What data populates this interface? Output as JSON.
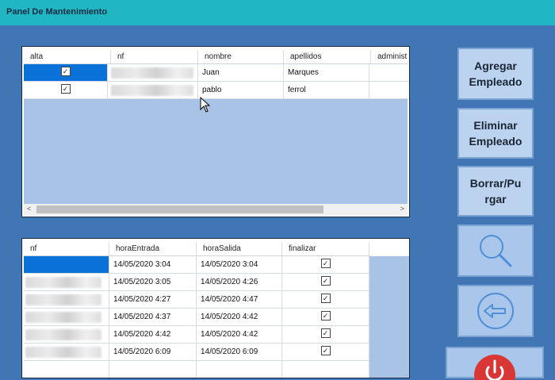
{
  "window": {
    "title": "Panel De Mantenimiento"
  },
  "empleados_grid": {
    "columns": [
      "alta",
      "nf",
      "nombre",
      "apellidos",
      "administ"
    ],
    "rows": [
      {
        "alta": true,
        "nf": "",
        "nombre": "Juan",
        "apellidos": "Marques"
      },
      {
        "alta": true,
        "nf": "",
        "nombre": "pablo",
        "apellidos": "ferrol"
      }
    ]
  },
  "fichajes_grid": {
    "columns": [
      "nf",
      "horaEntrada",
      "horaSalida",
      "finalizar"
    ],
    "rows": [
      {
        "nf": "",
        "horaEntrada": "14/05/2020 3:04",
        "horaSalida": "14/05/2020 3:04",
        "finalizar": true
      },
      {
        "nf": "",
        "horaEntrada": "14/05/2020 3:05",
        "horaSalida": "14/05/2020 4:26",
        "finalizar": true
      },
      {
        "nf": "",
        "horaEntrada": "14/05/2020 4:27",
        "horaSalida": "14/05/2020 4:47",
        "finalizar": true
      },
      {
        "nf": "",
        "horaEntrada": "14/05/2020 4:37",
        "horaSalida": "14/05/2020 4:42",
        "finalizar": true
      },
      {
        "nf": "",
        "horaEntrada": "14/05/2020 4:42",
        "horaSalida": "14/05/2020 4:42",
        "finalizar": true
      },
      {
        "nf": "",
        "horaEntrada": "14/05/2020 6:09",
        "horaSalida": "14/05/2020 6:09",
        "finalizar": true
      }
    ]
  },
  "buttons": {
    "agregar_line1": "Agregar",
    "agregar_line2": "Empleado",
    "eliminar_line1": "Eliminar",
    "eliminar_line2": "Empleado",
    "borrar_line1": "Borrar/Pu",
    "borrar_line2": "rgar",
    "search_icon": "magnifier-icon",
    "back_icon": "arrow-left-icon",
    "power_icon": "power-icon"
  },
  "colors": {
    "background": "#3f76b3",
    "titlebar": "#21b7c2",
    "selection": "#0a71d9",
    "button_face": "#bcd3ef",
    "power_button": "#d93636"
  }
}
